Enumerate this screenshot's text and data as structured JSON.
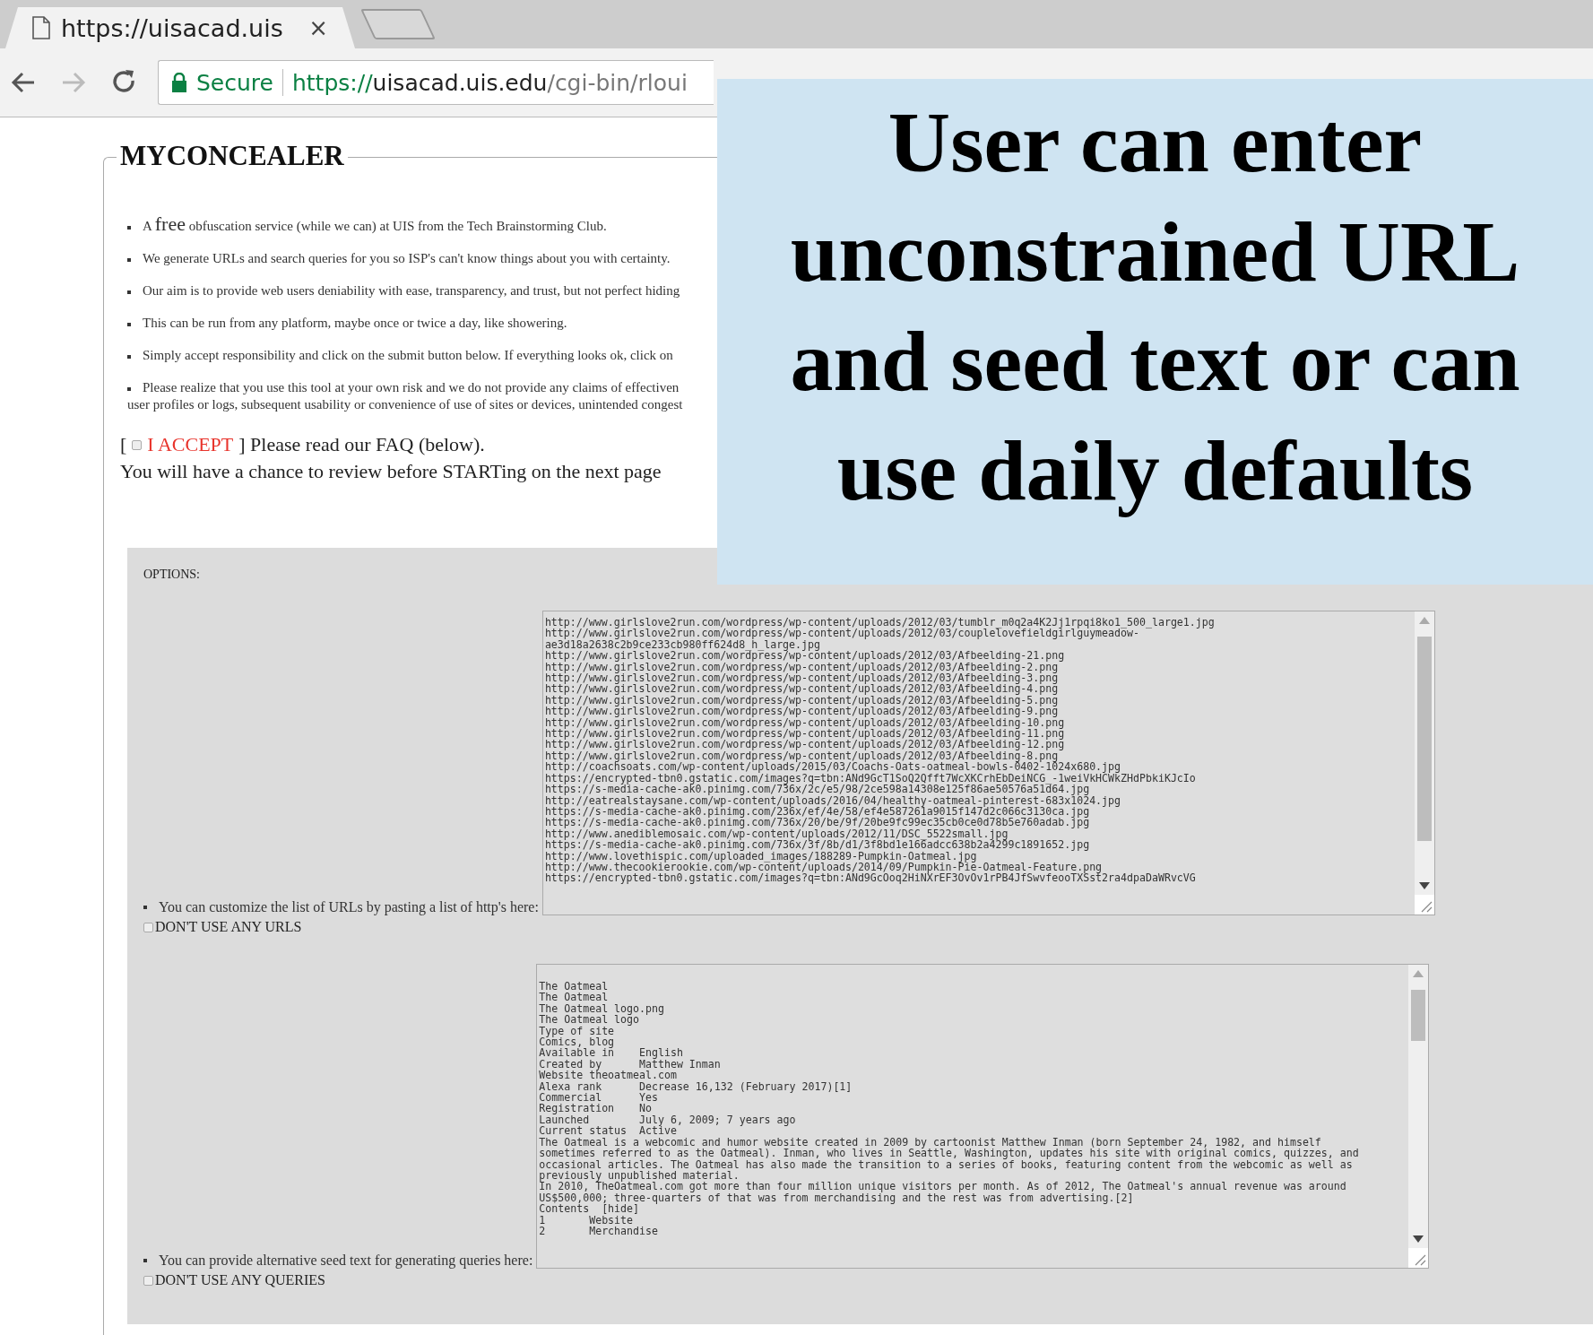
{
  "browser": {
    "tab_title": "https://uisacad.uis",
    "tab_close": "×",
    "secure_label": "Secure",
    "url_scheme": "https://",
    "url_host": "uisacad.uis.edu",
    "url_path": "/cgi-bin/rloui"
  },
  "page": {
    "title": "MYCONCEALER",
    "bullets": [
      {
        "lead": "A",
        "emphasis": "free",
        "text": "obfuscation service (while we can) at UIS from the Tech Brainstorming Club."
      },
      {
        "text": "We generate URLs and search queries for you so ISP's can't know things about you with certainty."
      },
      {
        "text": "Our aim is to provide web users deniability with ease, transparency, and trust, but not perfect hiding"
      },
      {
        "text": "This can be run from any platform, maybe once or twice a day, like showering."
      },
      {
        "text": "Simply accept responsibility and click on the submit button below. If everything looks ok, click on"
      },
      {
        "text": "Please realize that you use this tool at your own risk and we do not provide any claims of effectiven\nuser profiles or logs, subsequent usability or convenience of use of sites or devices, unintended congest"
      }
    ],
    "accept": {
      "open": "[",
      "checked": false,
      "label": "I ACCEPT",
      "text": "] Please read our FAQ (below)."
    },
    "review_note": "You will have a chance to review before STARTing on the next page"
  },
  "options": {
    "title": "OPTIONS:",
    "sections": [
      {
        "label": "You can customize the list of URLs by pasting a list of http's here:",
        "lines": [
          "http://www.girlslove2run.com/wordpress/wp-content/uploads/2012/03/tumblr_m0q2a4K2Jj1rpqi8ko1_500_large1.jpg",
          "http://www.girlslove2run.com/wordpress/wp-content/uploads/2012/03/couplelovefieldgirlguymeadow-",
          "ae3d18a2638c2b9ce233cb980ff624d8_h_large.jpg",
          "http://www.girlslove2run.com/wordpress/wp-content/uploads/2012/03/Afbeelding-21.png",
          "http://www.girlslove2run.com/wordpress/wp-content/uploads/2012/03/Afbeelding-2.png",
          "http://www.girlslove2run.com/wordpress/wp-content/uploads/2012/03/Afbeelding-3.png",
          "http://www.girlslove2run.com/wordpress/wp-content/uploads/2012/03/Afbeelding-4.png",
          "http://www.girlslove2run.com/wordpress/wp-content/uploads/2012/03/Afbeelding-5.png",
          "http://www.girlslove2run.com/wordpress/wp-content/uploads/2012/03/Afbeelding-9.png",
          "http://www.girlslove2run.com/wordpress/wp-content/uploads/2012/03/Afbeelding-10.png",
          "http://www.girlslove2run.com/wordpress/wp-content/uploads/2012/03/Afbeelding-11.png",
          "http://www.girlslove2run.com/wordpress/wp-content/uploads/2012/03/Afbeelding-12.png",
          "http://www.girlslove2run.com/wordpress/wp-content/uploads/2012/03/Afbeelding-8.png",
          "http://coachsoats.com/wp-content/uploads/2015/03/Coachs-Oats-oatmeal-bowls-0402-1024x680.jpg",
          "https://encrypted-tbn0.gstatic.com/images?q=tbn:ANd9GcT1SoQ2Qfft7WcXKCrhEbDeiNCG_-1weiVkHCWkZHdPbkiKJcIo",
          "https://s-media-cache-ak0.pinimg.com/736x/2c/e5/98/2ce598a14308e125f86ae50576a51d64.jpg",
          "http://eatrealstaysane.com/wp-content/uploads/2016/04/healthy-oatmeal-pinterest-683x1024.jpg",
          "https://s-media-cache-ak0.pinimg.com/236x/ef/4e/58/ef4e587261a9015f147d2c066c3130ca.jpg",
          "https://s-media-cache-ak0.pinimg.com/736x/20/be/9f/20be9fc99ec35cb0ce0d78b5e760adab.jpg",
          "http://www.anediblemosaic.com/wp-content/uploads/2012/11/DSC_5522small.jpg",
          "https://s-media-cache-ak0.pinimg.com/736x/3f/8b/d1/3f8bd1e166adcc638b2a4299c1891652.jpg",
          "http://www.lovethispic.com/uploaded_images/188289-Pumpkin-Oatmeal.jpg",
          "http://www.thecookierookie.com/wp-content/uploads/2014/09/Pumpkin-Pie-Oatmeal-Feature.png",
          "https://encrypted-tbn0.gstatic.com/images?q=tbn:ANd9GcOoq2HiNXrEF3OvOv1rPB4JfSwvfeooTXSst2ra4dpaDaWRvcVG"
        ],
        "opt_out": {
          "label": "DON'T USE ANY URLS",
          "checked": false
        }
      },
      {
        "label": "You can provide alternative seed text for generating queries here:",
        "lines": [
          "The Oatmeal",
          "The Oatmeal",
          "The Oatmeal logo.png",
          "The Oatmeal logo",
          "Type of site",
          "Comics, blog",
          "Available in    English",
          "Created by      Matthew Inman",
          "Website theoatmeal.com",
          "Alexa rank      Decrease 16,132 (February 2017)[1]",
          "Commercial      Yes",
          "Registration    No",
          "Launched        July 6, 2009; 7 years ago",
          "Current status  Active",
          "The Oatmeal is a webcomic and humor website created in 2009 by cartoonist Matthew Inman (born September 24, 1982, and himself",
          "sometimes referred to as the Oatmeal). Inman, who lives in Seattle, Washington, updates his site with original comics, quizzes, and",
          "occasional articles. The Oatmeal has also made the transition to a series of books, featuring content from the webcomic as well as",
          "previously unpublished material.",
          "In 2010, TheOatmeal.com got more than four million unique visitors per month. As of 2012, The Oatmeal's annual revenue was around",
          "US$500,000; three-quarters of that was from merchandising and the rest was from advertising.[2]",
          "Contents  [hide]",
          "1       Website",
          "2       Merchandise"
        ],
        "opt_out": {
          "label": "DON'T USE ANY QUERIES",
          "checked": false
        }
      }
    ]
  },
  "callout": {
    "lines": [
      "User can enter",
      "unconstrained URL",
      "and seed text or can",
      "use daily defaults"
    ]
  }
}
